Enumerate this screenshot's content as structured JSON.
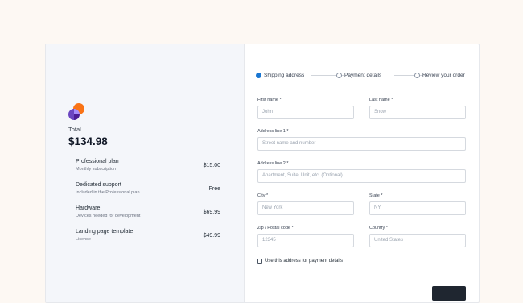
{
  "summary": {
    "total_label": "Total",
    "total_amount": "$134.98",
    "products": [
      {
        "name": "Professional plan",
        "desc": "Monthly subscription",
        "price": "$15.00"
      },
      {
        "name": "Dedicated support",
        "desc": "Included in the Professional plan",
        "price": "Free"
      },
      {
        "name": "Hardware",
        "desc": "Devices needed for development",
        "price": "$69.99"
      },
      {
        "name": "Landing page template",
        "desc": "License",
        "price": "$49.99"
      }
    ]
  },
  "steps": [
    {
      "label": "Shipping address",
      "active": true
    },
    {
      "label": "Payment details",
      "active": false
    },
    {
      "label": "Review your order",
      "active": false
    }
  ],
  "form": {
    "first_name": {
      "label": "First name *",
      "placeholder": "John"
    },
    "last_name": {
      "label": "Last name *",
      "placeholder": "Snow"
    },
    "address1": {
      "label": "Address line 1 *",
      "placeholder": "Street name and number"
    },
    "address2": {
      "label": "Address line 2 *",
      "placeholder": "Apartment, Suite, Unit, etc. (Optional)"
    },
    "city": {
      "label": "City *",
      "placeholder": "New York"
    },
    "state": {
      "label": "State *",
      "placeholder": "NY"
    },
    "zip": {
      "label": "Zip / Postal code *",
      "placeholder": "12345"
    },
    "country": {
      "label": "Country *",
      "placeholder": "United States"
    },
    "use_address_label": "Use this address for payment details"
  },
  "colors": {
    "accent": "#1976d2",
    "logo_orange": "#f97316",
    "logo_purple": "#6b46c1",
    "button_dark": "#1f2630"
  }
}
